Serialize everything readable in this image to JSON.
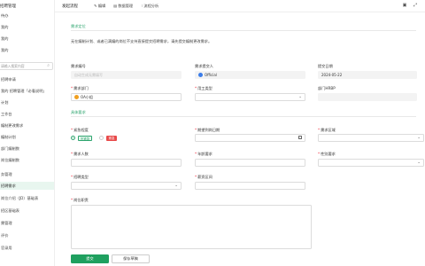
{
  "sidebar": {
    "title": "招聘管理",
    "search_placeholder": "请输入搜索内容",
    "items": [
      {
        "label": "待办"
      },
      {
        "label": "我的"
      },
      {
        "label": "我的"
      },
      {
        "label": "我的"
      },
      {
        "label": "招聘申请"
      },
      {
        "label": "我的 招聘管理「必看说明」"
      },
      {
        "label": "计划"
      },
      {
        "label": "工作台"
      },
      {
        "label": "编制更改需求"
      },
      {
        "label": "编制计划"
      },
      {
        "label": "部门编制数"
      },
      {
        "label": "岗位编制数"
      },
      {
        "label": "务管理"
      },
      {
        "label": "招聘需求"
      },
      {
        "label": "岗位介绍（JD）基础表"
      },
      {
        "label": "招区基础表"
      },
      {
        "label": "需管理"
      },
      {
        "label": "评价"
      },
      {
        "label": "官录用"
      }
    ],
    "active_index": 13
  },
  "topbar": {
    "title": "发起流程",
    "links": [
      "编辑",
      "数据管理",
      "流程分析"
    ]
  },
  "form": {
    "section1_title": "需求定位",
    "notice": "无在编制计划、或者已满编的岗位不支持直接提交招聘需求，请先提交编制更改需求。",
    "req_no": {
      "label": "需求编号",
      "placeholder": "自动生成无需填写"
    },
    "submitter": {
      "label": "需求提交人",
      "value": "Official"
    },
    "submit_date": {
      "label": "提交日期",
      "value": "2024-05-22"
    },
    "dept": {
      "label": "需求部门",
      "value": "OA小组"
    },
    "employee_type": {
      "label": "用工类型"
    },
    "hrbp": {
      "label": "部门HRBP"
    },
    "section2_title": "具体要求",
    "urgent": {
      "label": "紧急程度",
      "options": [
        "不紧急",
        "紧急"
      ],
      "selected": "不紧急"
    },
    "expected_date": {
      "label": "期望到岗日期"
    },
    "region": {
      "label": "需求区域"
    },
    "headcount": {
      "label": "需求人数"
    },
    "age": {
      "label": "年龄要求"
    },
    "gender": {
      "label": "性别要求"
    },
    "recruit_type": {
      "label": "招聘类型"
    },
    "salary_range": {
      "label": "薪资区间"
    },
    "job_duties": {
      "label": "岗位职责"
    }
  },
  "actions": {
    "submit": "提交",
    "save_draft": "保存草稿"
  },
  "colors": {
    "accent": "#1fa05f",
    "active_bg": "#e8f6ef",
    "danger": "#e84a4a"
  }
}
